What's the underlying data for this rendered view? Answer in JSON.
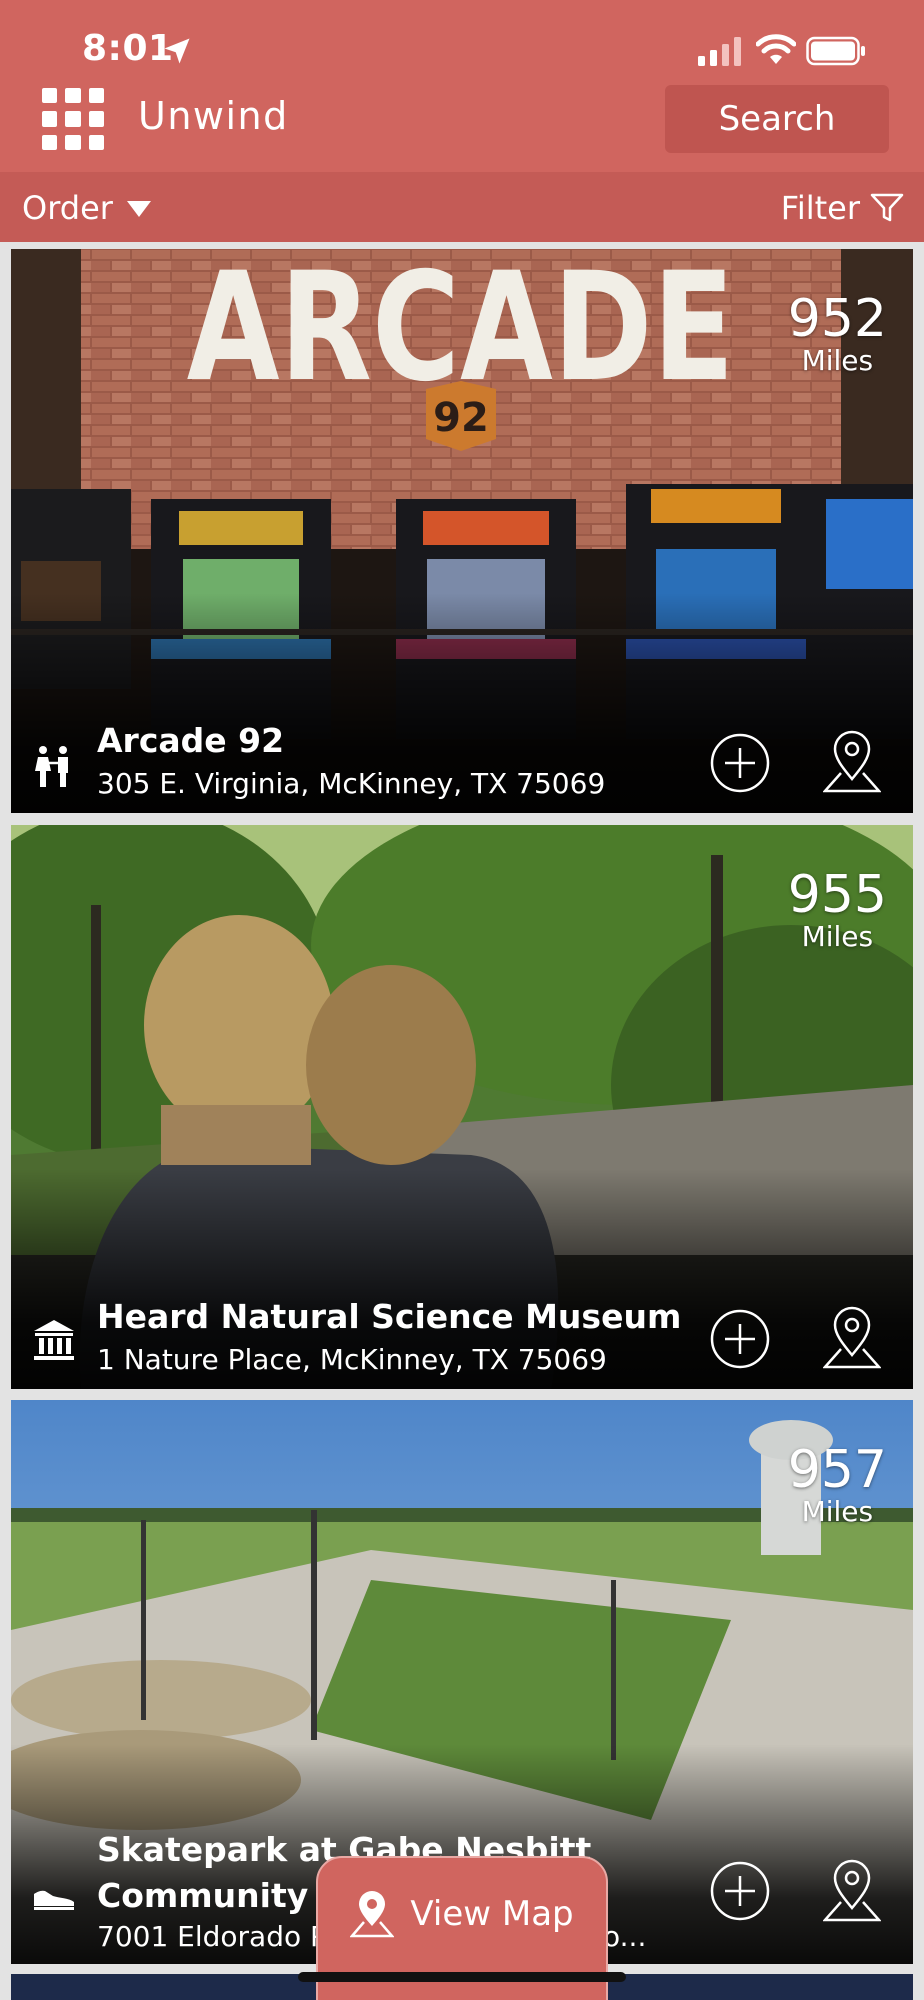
{
  "status_bar": {
    "time": "8:01"
  },
  "header": {
    "title": "Unwind",
    "search_label": "Search"
  },
  "toolbar": {
    "order_label": "Order",
    "filter_label": "Filter"
  },
  "cards": [
    {
      "name": "Arcade 92",
      "name_line2": "",
      "address": "305 E. Virginia, McKinney, TX 75069",
      "distance": "952",
      "distance_unit": "Miles",
      "category_icon": "family-icon"
    },
    {
      "name": "Heard Natural Science Museum",
      "name_line2": "",
      "address": "1 Nature Place, McKinney, TX 75069",
      "distance": "955",
      "distance_unit": "Miles",
      "category_icon": "museum-icon"
    },
    {
      "name": "Skatepark at Gabe Nesbitt",
      "name_line2": "Community P",
      "address": "7001 Eldorado P",
      "address_tail": "o...",
      "distance": "957",
      "distance_unit": "Miles",
      "category_icon": "sneaker-icon"
    }
  ],
  "map_button": {
    "label": "View Map"
  }
}
